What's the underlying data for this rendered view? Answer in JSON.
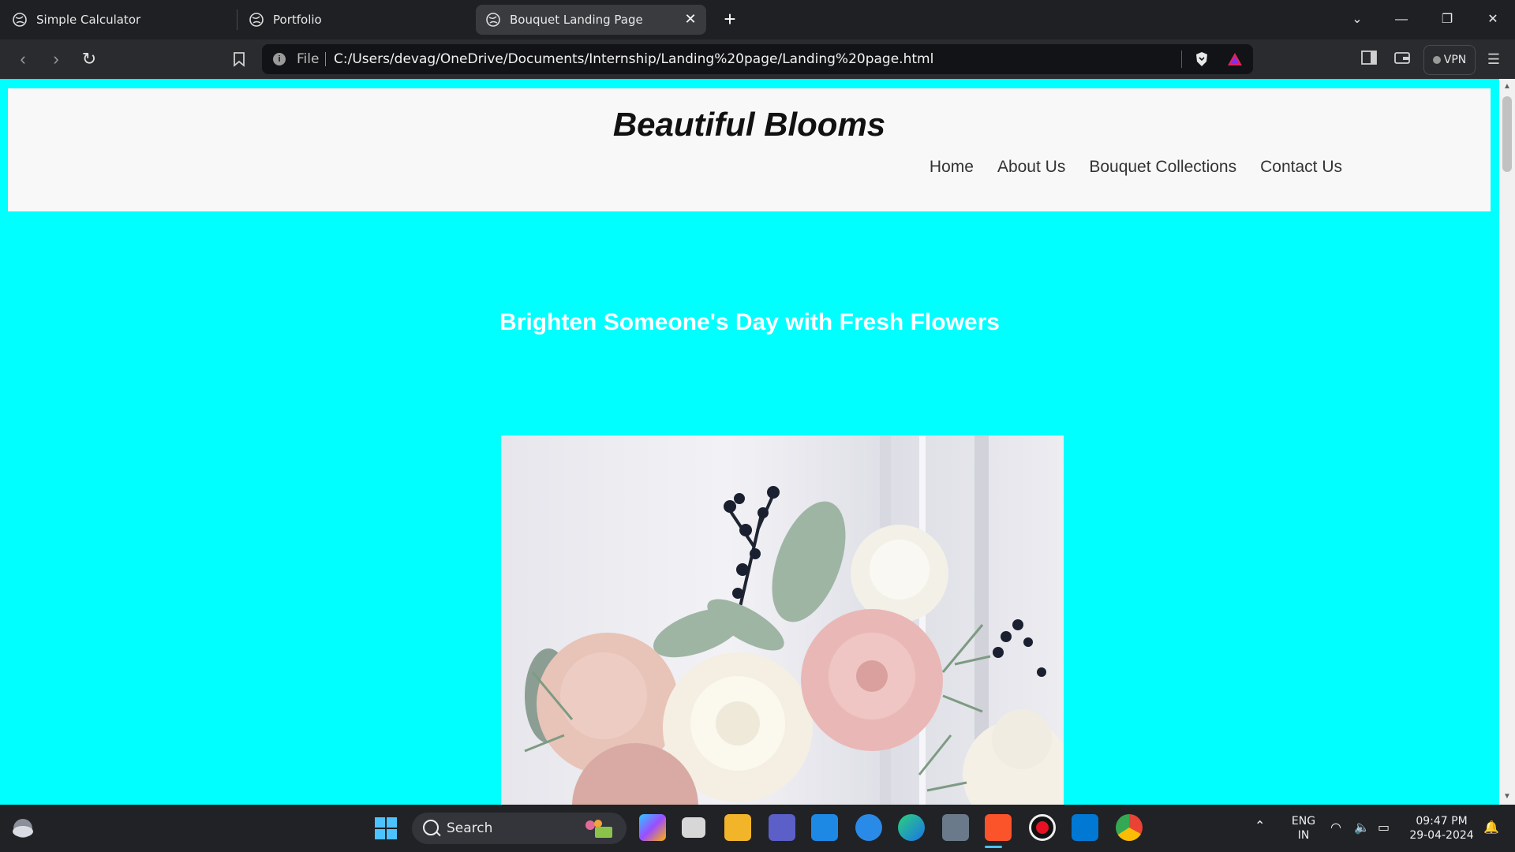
{
  "browser": {
    "tabs": [
      {
        "title": "Simple Calculator",
        "active": false
      },
      {
        "title": "Portfolio",
        "active": false
      },
      {
        "title": "Bouquet Landing Page",
        "active": true
      }
    ],
    "address": {
      "scheme_label": "File",
      "url": "C:/Users/devag/OneDrive/Documents/Internship/Landing%20page/Landing%20page.html"
    },
    "vpn_label": "VPN"
  },
  "page": {
    "site_title": "Beautiful Blooms",
    "nav": [
      "Home",
      "About Us",
      "Bouquet Collections",
      "Contact Us"
    ],
    "hero_heading": "Brighten Someone's Day with Fresh Flowers",
    "background_color": "#00ffff",
    "header_color": "#f8f8f8"
  },
  "taskbar": {
    "search_label": "Search",
    "language": "ENG",
    "region": "IN",
    "time": "09:47 PM",
    "date": "29-04-2024"
  }
}
